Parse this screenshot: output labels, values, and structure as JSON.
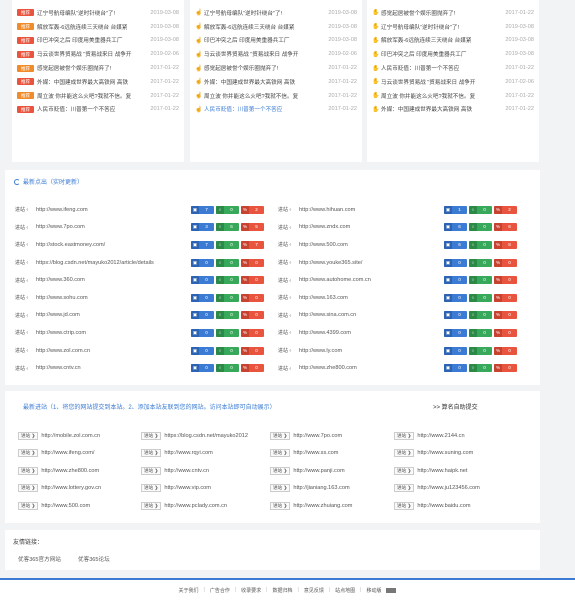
{
  "news_columns": [
    {
      "items": [
        {
          "tag": "推荐",
          "tag_color": "red",
          "title": "辽宁号航母编队“逆时针绕台”了!",
          "date": "2019-03-08"
        },
        {
          "tag": "推荐",
          "tag_color": "orange",
          "title": "解放军轰-6远航连续三天绕台 台媒紧",
          "date": "2019-03-08"
        },
        {
          "tag": "推荐",
          "tag_color": "red",
          "title": "印巴冲突之后 印度用美重器兵工厂",
          "date": "2019-03-08"
        },
        {
          "tag": "推荐",
          "tag_color": "red",
          "title": "马云谈世界贸易战 “贸易战来日 战争开",
          "date": "2019-02-06"
        },
        {
          "tag": "推荐",
          "tag_color": "orange",
          "title": "感觉起居被誉个娱乐圈抛弃了!",
          "date": "2017-01-22"
        },
        {
          "tag": "推荐",
          "tag_color": "red",
          "title": "外媒：中国建成世界最大高铁网 高铁",
          "date": "2017-01-22"
        },
        {
          "tag": "推荐",
          "tag_color": "orange",
          "title": "周立波 你并能这么火吧?我就不信。复",
          "date": "2017-01-22"
        },
        {
          "tag": "推荐",
          "tag_color": "red",
          "title": "人民币贬值：川普第一个不答应",
          "date": "2017-01-22"
        }
      ]
    },
    {
      "items": [
        {
          "icon": "thumb-icon",
          "title": "辽宁号航母编队“逆时针绕台”了!",
          "date": "2019-03-08"
        },
        {
          "icon": "thumb-icon",
          "title": "解放军轰-6远航连续三天绕台 台媒紧",
          "date": "2019-03-08"
        },
        {
          "icon": "thumb-icon",
          "title": "印巴冲突之后 印度用美重器兵工厂",
          "date": "2019-03-08"
        },
        {
          "icon": "thumb-icon",
          "title": "马云谈世界贸易战 “贸易战来日 战争开",
          "date": "2019-02-06"
        },
        {
          "icon": "thumb-icon",
          "title": "感觉起居被誉个娱乐圈抛弃了!",
          "date": "2017-01-22"
        },
        {
          "icon": "thumb-icon",
          "title": "外媒：中国建成世界最大高铁网 高铁",
          "date": "2017-01-22"
        },
        {
          "icon": "thumb-icon",
          "title": "周立波 你并能这么火吧?我就不信。复",
          "date": "2017-01-22"
        },
        {
          "icon": "thumb-icon",
          "title": "人民币贬值：川普第一个不答应",
          "date": "2017-01-22",
          "highlight": true
        }
      ]
    },
    {
      "items": [
        {
          "icon": "hand-icon",
          "title": "感觉起居被誉个娱乐圈抛弃了!",
          "date": "2017-01-22"
        },
        {
          "icon": "hand-icon",
          "title": "辽宁号航母编队“逆时针绕台”了!",
          "date": "2019-03-08"
        },
        {
          "icon": "hand-icon",
          "title": "解放军轰-6远航连续三天绕台 台媒紧",
          "date": "2019-03-08"
        },
        {
          "icon": "hand-icon",
          "title": "印巴冲突之后 印度用美重器兵工厂",
          "date": "2019-03-08"
        },
        {
          "icon": "hand-icon",
          "title": "人民币贬值：川普第一个不答应",
          "date": "2017-01-22"
        },
        {
          "icon": "hand-icon",
          "title": "马云谈世界贸易战 “贸易战来日 战争开",
          "date": "2017-02-06"
        },
        {
          "icon": "hand-icon",
          "title": "周立波 你并能这么火吧?我就不信。复",
          "date": "2017-01-22"
        },
        {
          "icon": "hand-icon",
          "title": "外媒：中国建成世界最大高铁网 高铁",
          "date": "2017-01-22"
        }
      ]
    }
  ],
  "latest_clicks": {
    "title": "最新点出（实时更新）",
    "jump_label": "进站",
    "left": [
      {
        "url": "http://www.ifeng.com",
        "s": [
          "7",
          "0",
          "2"
        ]
      },
      {
        "url": "http://www.7po.com",
        "s": [
          "3",
          "6",
          "5"
        ]
      },
      {
        "url": "http://stock.eastmoney.com/",
        "s": [
          "7",
          "0",
          "7"
        ]
      },
      {
        "url": "https://blog.csdn.net/mayuko2012/article/details",
        "s": [
          "0",
          "0",
          "0"
        ]
      },
      {
        "url": "http://www.360.com",
        "s": [
          "0",
          "0",
          "0"
        ]
      },
      {
        "url": "http://www.sohu.com",
        "s": [
          "0",
          "0",
          "0"
        ]
      },
      {
        "url": "http://www.jd.com",
        "s": [
          "0",
          "0",
          "0"
        ]
      },
      {
        "url": "http://www.ctrip.com",
        "s": [
          "0",
          "0",
          "0"
        ]
      },
      {
        "url": "http://www.zol.com.cn",
        "s": [
          "0",
          "0",
          "0"
        ]
      },
      {
        "url": "http://www.cntv.cn",
        "s": [
          "0",
          "0",
          "0"
        ]
      }
    ],
    "right": [
      {
        "url": "http://www.hihuan.com",
        "s": [
          "1",
          "0",
          "2"
        ]
      },
      {
        "url": "http://www.zndx.com",
        "s": [
          "6",
          "0",
          "6"
        ]
      },
      {
        "url": "http://www.500.com",
        "s": [
          "6",
          "0",
          "8"
        ]
      },
      {
        "url": "http://www.youke365.site/",
        "s": [
          "0",
          "0",
          "0"
        ]
      },
      {
        "url": "http://www.autohome.com.cn",
        "s": [
          "0",
          "0",
          "0"
        ]
      },
      {
        "url": "http://www.163.com",
        "s": [
          "0",
          "0",
          "0"
        ]
      },
      {
        "url": "http://www.sina.com.cn",
        "s": [
          "0",
          "0",
          "0"
        ]
      },
      {
        "url": "http://www.4399.com",
        "s": [
          "0",
          "0",
          "0"
        ]
      },
      {
        "url": "http://www.ly.com",
        "s": [
          "0",
          "0",
          "0"
        ]
      },
      {
        "url": "http://www.zhe800.com",
        "s": [
          "0",
          "0",
          "0"
        ]
      }
    ]
  },
  "recent": {
    "title": "最新进站（1、将您的网站提交到本站。2、添加本站友联到您的网站。访问本站即可自动展示）",
    "more": ">> 算名自助提交",
    "jump_label": "进站",
    "cols": [
      [
        "http://mobile.zol.com.cn",
        "http://www.ifeng.com/",
        "http://www.zhe800.com",
        "http://www.lottery.gov.cn",
        "http://www.500.com"
      ],
      [
        "https://blog.csdn.net/mayuko2012",
        "http://www.rqyi.com",
        "http://www.cntv.cn",
        "http://www.vip.com",
        "http://www.pclady.com.cn"
      ],
      [
        "http://www.7po.com",
        "http://www.ss.com",
        "http://www.panji.com",
        "http://jianiang.163.com",
        "http://www.zhuiang.com"
      ],
      [
        "http://www.2144.cn",
        "http://www.suning.com",
        "http://www.haipk.net",
        "http://www.ju123456.com",
        "http://www.baidu.com"
      ]
    ]
  },
  "friend_links": {
    "title": "友情链接：",
    "items": [
      "优客365官方网站",
      "优客365论坛"
    ]
  },
  "footer": {
    "links": [
      "关于我们",
      "广告合作",
      "收录要求",
      "数据归档",
      "意见反馈",
      "站点地图",
      "移动版"
    ]
  }
}
